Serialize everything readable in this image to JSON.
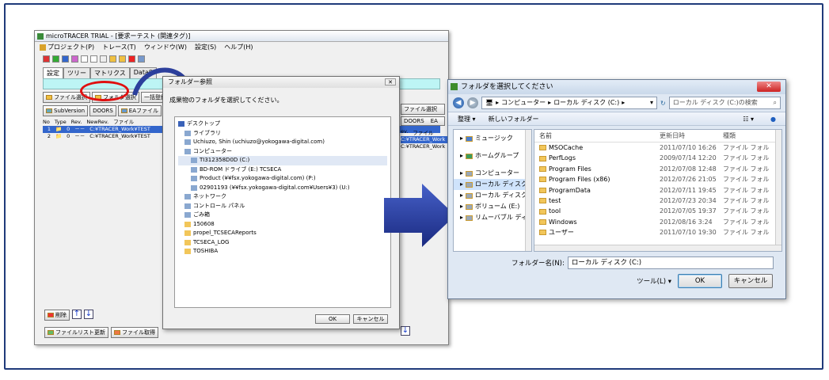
{
  "win1": {
    "title": "microTRACER TRIAL - [要求ーテスト (関連タグ)]",
    "menu": [
      "プロジェクト(P)",
      "トレース(T)",
      "ウィンドウ(W)",
      "設定(S)",
      "ヘルプ(H)"
    ],
    "tabs": [
      "設定",
      "ツリー",
      "マトリクス",
      "DataS"
    ],
    "buttons": {
      "file_select": "ファイル選択",
      "folder_select": "フォルダ選択",
      "bulk": "一括登録",
      "subversion": "SubVersion",
      "doors": "DOORS",
      "ea_file": "EAファイル"
    },
    "grid_headers": [
      "No",
      "Type",
      "Rev.",
      "NewRev.",
      "ファイル"
    ],
    "rows": [
      {
        "no": "1",
        "type": "📁",
        "rev": "0",
        "newrev": "－－",
        "file": "C:¥TRACER_Work¥TEST"
      },
      {
        "no": "2",
        "type": "📁",
        "rev": "0",
        "newrev": "－－",
        "file": "C:¥TRACER_Work¥TEST"
      }
    ],
    "delete": "削除",
    "file_list_update": "ファイルリスト更新",
    "file_get": "ファイル取得",
    "right_buttons": [
      "ファイル選択",
      "DOORS",
      "EA"
    ],
    "right_headers": [
      "ev.",
      "ファイル"
    ],
    "right_rows": [
      "C:¥TRACER_Work",
      "C:¥TRACER_Work"
    ]
  },
  "dlg1": {
    "title": "フォルダー参照",
    "message": "成果物のフォルダを選択してください。",
    "tree": [
      {
        "label": "デスクトップ",
        "level": 0
      },
      {
        "label": "ライブラリ",
        "level": 1
      },
      {
        "label": "Uchiuzo, Shin (uchiuzo@yokogawa-digital.com)",
        "level": 1
      },
      {
        "label": "コンピューター",
        "level": 1
      },
      {
        "label": "TI312358D0D (C:)",
        "level": 2
      },
      {
        "label": "BD-ROM ドライブ (E:) TCSECA",
        "level": 2
      },
      {
        "label": "Product (¥¥fsx.yokogawa-digital.com) (P:)",
        "level": 2
      },
      {
        "label": "02901193 (¥¥fsx.yokogawa-digital.com¥Users¥3) (U:)",
        "level": 2
      },
      {
        "label": "ネットワーク",
        "level": 1
      },
      {
        "label": "コントロール パネル",
        "level": 1
      },
      {
        "label": "ごみ箱",
        "level": 1
      },
      {
        "label": "150608",
        "level": 1
      },
      {
        "label": "propel_TCSECAReports",
        "level": 1
      },
      {
        "label": "TCSECA_LOG",
        "level": 1
      },
      {
        "label": "TOSHIBA",
        "level": 1
      }
    ],
    "ok": "OK",
    "cancel": "キャンセル"
  },
  "win2": {
    "title": "フォルダを選択してください",
    "address": [
      "コンピューター",
      "ローカル ディスク (C:)"
    ],
    "search_placeholder": "ローカル ディスク (C:)の検索",
    "organize": "整理 ▾",
    "new_folder": "新しいフォルダー",
    "nav": [
      {
        "label": "ミュージック",
        "sel": false
      },
      {
        "label": "ホームグループ",
        "sel": false
      },
      {
        "label": "コンピューター",
        "sel": false
      },
      {
        "label": "ローカル ディスク",
        "sel": true
      },
      {
        "label": "ローカル ディスク",
        "sel": false
      },
      {
        "label": "ボリューム (E:)",
        "sel": false
      },
      {
        "label": "リムーバブル ディ",
        "sel": false
      }
    ],
    "headers": [
      "名前",
      "更新日時",
      "種類"
    ],
    "files": [
      {
        "name": "MSOCache",
        "date": "2011/07/10 16:26",
        "kind": "ファイル フォル"
      },
      {
        "name": "PerfLogs",
        "date": "2009/07/14 12:20",
        "kind": "ファイル フォル"
      },
      {
        "name": "Program Files",
        "date": "2012/07/08 12:48",
        "kind": "ファイル フォル"
      },
      {
        "name": "Program Files (x86)",
        "date": "2012/07/26 21:05",
        "kind": "ファイル フォル"
      },
      {
        "name": "ProgramData",
        "date": "2012/07/11 19:45",
        "kind": "ファイル フォル"
      },
      {
        "name": "test",
        "date": "2012/07/23 20:34",
        "kind": "ファイル フォル"
      },
      {
        "name": "tool",
        "date": "2012/07/05 19:37",
        "kind": "ファイル フォル"
      },
      {
        "name": "Windows",
        "date": "2012/08/16 3:24",
        "kind": "ファイル フォル"
      },
      {
        "name": "ユーザー",
        "date": "2011/07/10 19:30",
        "kind": "ファイル フォル"
      }
    ],
    "folder_name_label": "フォルダー名(N):",
    "folder_name_value": "ローカル ディスク (C:)",
    "tools": "ツール(L)",
    "ok": "OK",
    "cancel": "キャンセル"
  },
  "colors": {
    "frame": "#1f3a7a",
    "arrow": "#2c3f9c",
    "highlight": "#e01010"
  }
}
